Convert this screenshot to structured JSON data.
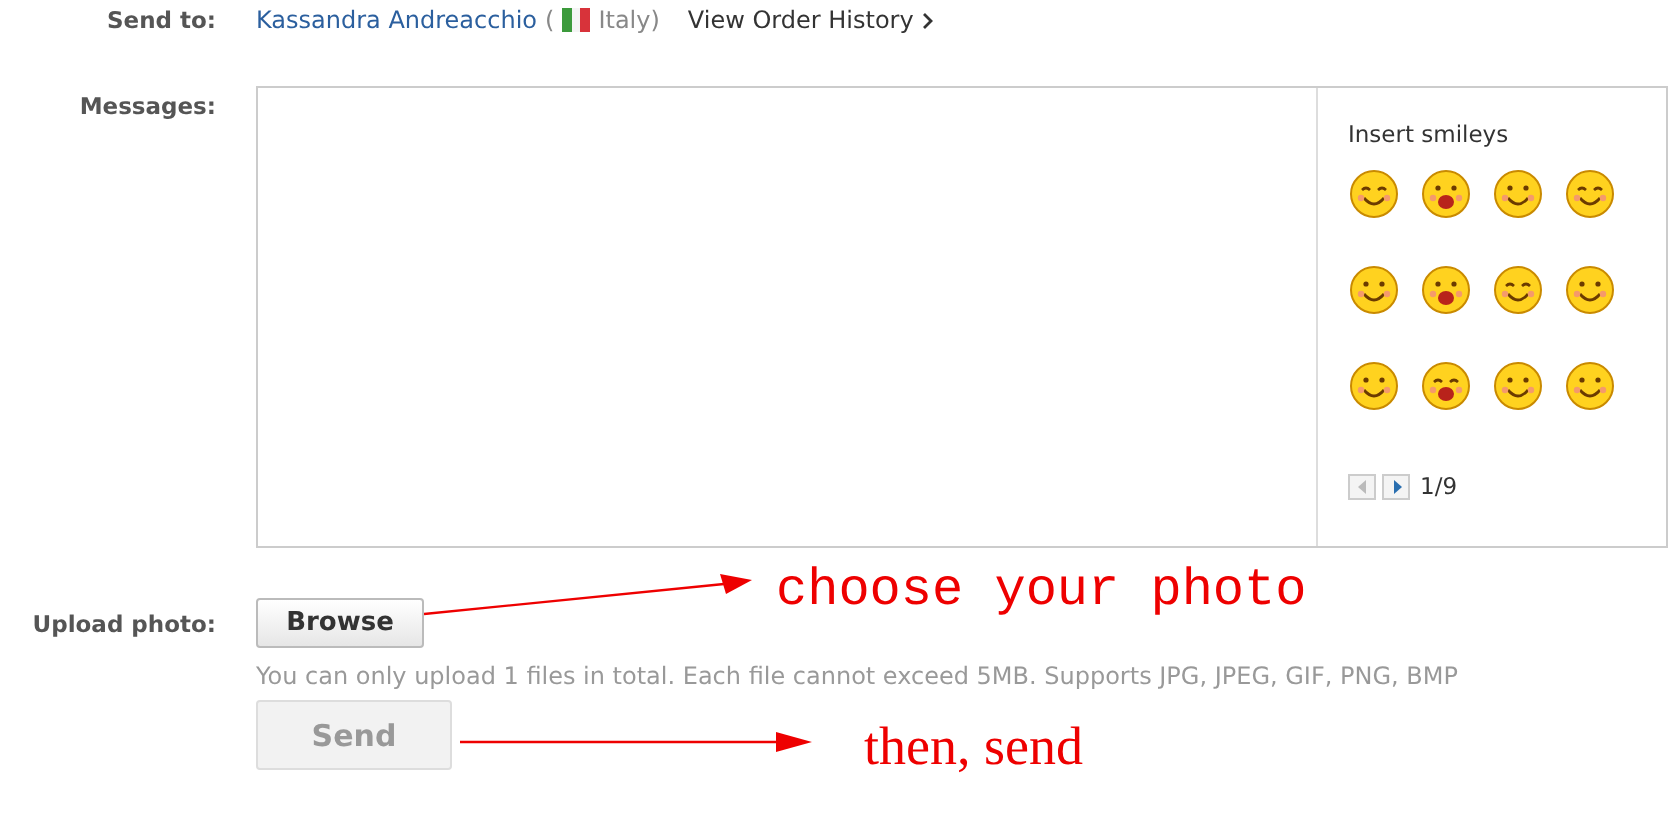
{
  "send_to": {
    "label": "Send to:",
    "recipient": "Kassandra Andreacchio",
    "country_open": "(",
    "country": "Italy)",
    "history_link": "View Order History"
  },
  "messages": {
    "label": "Messages:"
  },
  "smileys": {
    "title": "Insert smileys",
    "prev_disabled": true,
    "next_disabled": false,
    "page": "1/9"
  },
  "upload": {
    "label": "Upload photo:",
    "button": "Browse",
    "hint": "You can only upload 1 files in total. Each file cannot exceed 5MB. Supports JPG, JPEG, GIF, PNG, BMP"
  },
  "send": {
    "label": "Send",
    "disabled": true
  },
  "annotations": [
    {
      "text": "choose your photo"
    },
    {
      "text": "then, send"
    }
  ]
}
